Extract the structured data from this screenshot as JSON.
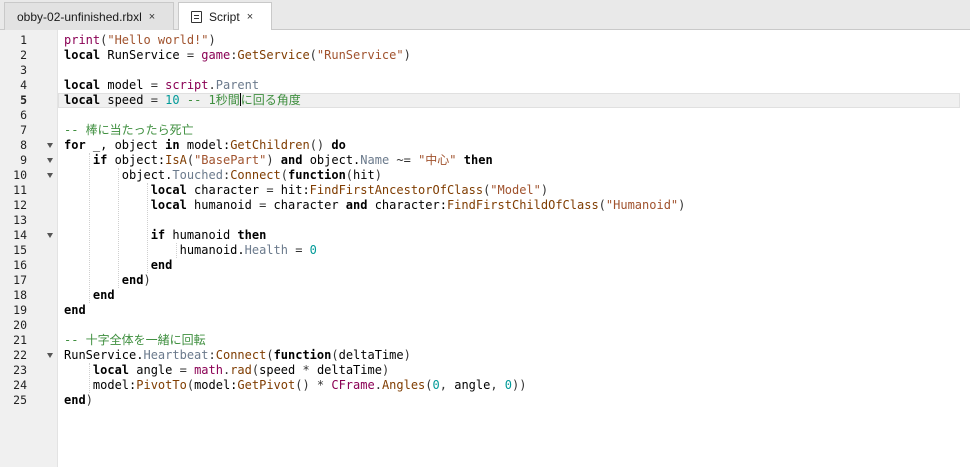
{
  "tabs": [
    {
      "label": "obby-02-unfinished.rbxl",
      "close": "×"
    },
    {
      "label": "Script",
      "close": "×",
      "icon": "script-icon"
    }
  ],
  "editor": {
    "current_line": 5,
    "fold_lines": [
      8,
      9,
      10,
      14,
      22
    ],
    "lines": [
      [
        [
          "builtin",
          "print"
        ],
        [
          "op",
          "("
        ],
        [
          "str",
          "\"Hello world!\""
        ],
        [
          "op",
          ")"
        ]
      ],
      [
        [
          "kw",
          "local"
        ],
        [
          "t",
          " RunService "
        ],
        [
          "op",
          "= "
        ],
        [
          "builtin",
          "game"
        ],
        [
          "op",
          ":"
        ],
        [
          "method",
          "GetService"
        ],
        [
          "op",
          "("
        ],
        [
          "str",
          "\"RunService\""
        ],
        [
          "op",
          ")"
        ]
      ],
      [],
      [
        [
          "kw",
          "local"
        ],
        [
          "t",
          " model "
        ],
        [
          "op",
          "= "
        ],
        [
          "builtin",
          "script"
        ],
        [
          "op",
          "."
        ],
        [
          "prop",
          "Parent"
        ]
      ],
      [
        [
          "kw",
          "local"
        ],
        [
          "t",
          " speed "
        ],
        [
          "op",
          "= "
        ],
        [
          "num",
          "10"
        ],
        [
          "t",
          " "
        ],
        [
          "cmt",
          "-- 1秒間"
        ],
        [
          "cursor",
          ""
        ],
        [
          "cmt",
          "に回る角度"
        ]
      ],
      [],
      [
        [
          "cmt",
          "-- 棒に当たったら死亡"
        ]
      ],
      [
        [
          "kw",
          "for"
        ],
        [
          "t",
          " _, object "
        ],
        [
          "kw",
          "in"
        ],
        [
          "t",
          " model:"
        ],
        [
          "method",
          "GetChildren"
        ],
        [
          "op",
          "() "
        ],
        [
          "kw",
          "do"
        ]
      ],
      [
        [
          "t",
          "    "
        ],
        [
          "kw",
          "if"
        ],
        [
          "t",
          " object:"
        ],
        [
          "method",
          "IsA"
        ],
        [
          "op",
          "("
        ],
        [
          "str",
          "\"BasePart\""
        ],
        [
          "op",
          ") "
        ],
        [
          "kw",
          "and"
        ],
        [
          "t",
          " object."
        ],
        [
          "prop",
          "Name"
        ],
        [
          "op",
          " ~= "
        ],
        [
          "str",
          "\"中心\""
        ],
        [
          "t",
          " "
        ],
        [
          "kw",
          "then"
        ]
      ],
      [
        [
          "t",
          "        object."
        ],
        [
          "prop",
          "Touched"
        ],
        [
          "op",
          ":"
        ],
        [
          "method",
          "Connect"
        ],
        [
          "op",
          "("
        ],
        [
          "kw",
          "function"
        ],
        [
          "op",
          "("
        ],
        [
          "t",
          "hit"
        ],
        [
          "op",
          ")"
        ]
      ],
      [
        [
          "t",
          "            "
        ],
        [
          "kw",
          "local"
        ],
        [
          "t",
          " character "
        ],
        [
          "op",
          "= "
        ],
        [
          "t",
          "hit:"
        ],
        [
          "method",
          "FindFirstAncestorOfClass"
        ],
        [
          "op",
          "("
        ],
        [
          "str",
          "\"Model\""
        ],
        [
          "op",
          ")"
        ]
      ],
      [
        [
          "t",
          "            "
        ],
        [
          "kw",
          "local"
        ],
        [
          "t",
          " humanoid "
        ],
        [
          "op",
          "= "
        ],
        [
          "t",
          "character "
        ],
        [
          "kw",
          "and"
        ],
        [
          "t",
          " character:"
        ],
        [
          "method",
          "FindFirstChildOfClass"
        ],
        [
          "op",
          "("
        ],
        [
          "str",
          "\"Humanoid\""
        ],
        [
          "op",
          ")"
        ]
      ],
      [],
      [
        [
          "t",
          "            "
        ],
        [
          "kw",
          "if"
        ],
        [
          "t",
          " humanoid "
        ],
        [
          "kw",
          "then"
        ]
      ],
      [
        [
          "t",
          "                humanoid."
        ],
        [
          "prop",
          "Health"
        ],
        [
          "op",
          " = "
        ],
        [
          "num",
          "0"
        ]
      ],
      [
        [
          "t",
          "            "
        ],
        [
          "kw",
          "end"
        ]
      ],
      [
        [
          "t",
          "        "
        ],
        [
          "kw",
          "end"
        ],
        [
          "op",
          ")"
        ]
      ],
      [
        [
          "t",
          "    "
        ],
        [
          "kw",
          "end"
        ]
      ],
      [
        [
          "kw",
          "end"
        ]
      ],
      [],
      [
        [
          "cmt",
          "-- 十字全体を一緒に回転"
        ]
      ],
      [
        [
          "t",
          "RunService."
        ],
        [
          "prop",
          "Heartbeat"
        ],
        [
          "op",
          ":"
        ],
        [
          "method",
          "Connect"
        ],
        [
          "op",
          "("
        ],
        [
          "kw",
          "function"
        ],
        [
          "op",
          "("
        ],
        [
          "t",
          "deltaTime"
        ],
        [
          "op",
          ")"
        ]
      ],
      [
        [
          "t",
          "    "
        ],
        [
          "kw",
          "local"
        ],
        [
          "t",
          " angle "
        ],
        [
          "op",
          "= "
        ],
        [
          "builtin",
          "math"
        ],
        [
          "op",
          "."
        ],
        [
          "method",
          "rad"
        ],
        [
          "op",
          "("
        ],
        [
          "t",
          "speed "
        ],
        [
          "op",
          "* "
        ],
        [
          "t",
          "deltaTime"
        ],
        [
          "op",
          ")"
        ]
      ],
      [
        [
          "t",
          "    model:"
        ],
        [
          "method",
          "PivotTo"
        ],
        [
          "op",
          "("
        ],
        [
          "t",
          "model:"
        ],
        [
          "method",
          "GetPivot"
        ],
        [
          "op",
          "() * "
        ],
        [
          "builtin",
          "CFrame"
        ],
        [
          "op",
          "."
        ],
        [
          "method",
          "Angles"
        ],
        [
          "op",
          "("
        ],
        [
          "num",
          "0"
        ],
        [
          "op",
          ", "
        ],
        [
          "t",
          "angle"
        ],
        [
          "op",
          ", "
        ],
        [
          "num",
          "0"
        ],
        [
          "op",
          "))"
        ]
      ],
      [
        [
          "kw",
          "end"
        ],
        [
          "op",
          ")"
        ]
      ]
    ]
  }
}
